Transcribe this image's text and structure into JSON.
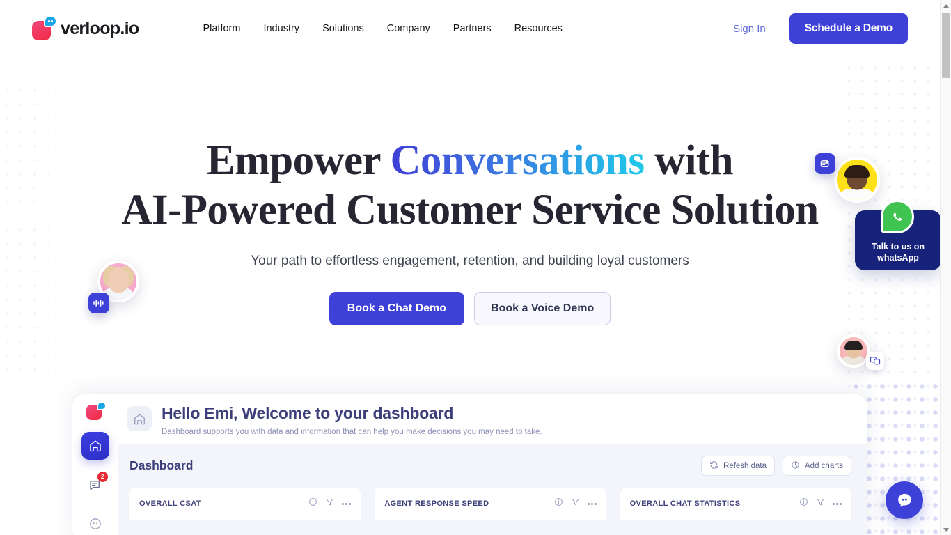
{
  "brand": {
    "logo_text": "verloop.io",
    "accent": "#3e41d8",
    "logo_pink": "#f12a43",
    "logo_blue": "#1aa5e8"
  },
  "header": {
    "nav": [
      {
        "label": "Platform"
      },
      {
        "label": "Industry"
      },
      {
        "label": "Solutions"
      },
      {
        "label": "Company"
      },
      {
        "label": "Partners"
      },
      {
        "label": "Resources"
      }
    ],
    "sign_in": "Sign In",
    "demo_button": "Schedule a Demo"
  },
  "hero": {
    "line1_pre": "Empower ",
    "line1_accent": "Conversations",
    "line1_post": " with",
    "line2": "AI-Powered Customer Service Solution",
    "subtitle": "Your path to effortless engagement, retention, and building loyal customers",
    "cta_primary": "Book a Chat Demo",
    "cta_secondary": "Book a Voice Demo",
    "gradient_from": "#3f3fd6",
    "gradient_to": "#1fc9ea"
  },
  "whatsapp_widget": {
    "line1": "Talk to us on",
    "line2": "whatsApp",
    "card_color": "#17237a",
    "bubble_color": "#3fc351"
  },
  "dashboard": {
    "welcome_title": "Hello Emi, Welcome to your dashboard",
    "welcome_subtitle": "Dashboard supports you with data and information that can help you make decisions you may need to take.",
    "section_title": "Dashboard",
    "actions": [
      {
        "label": "Refesh data",
        "icon": "refresh-icon"
      },
      {
        "label": "Add charts",
        "icon": "pie-chart-icon"
      }
    ],
    "sidebar": [
      {
        "name": "logo",
        "badge": ""
      },
      {
        "name": "home",
        "badge": "",
        "active": true
      },
      {
        "name": "messages",
        "badge": "2"
      },
      {
        "name": "contacts",
        "badge": ""
      }
    ],
    "cards": [
      {
        "title": "OVERALL CSAT"
      },
      {
        "title": "AGENT RESPONSE SPEED"
      },
      {
        "title": "OVERALL CHAT STATISTICS"
      }
    ]
  },
  "chat_launcher": {
    "label": "chat-bubble-icon"
  }
}
